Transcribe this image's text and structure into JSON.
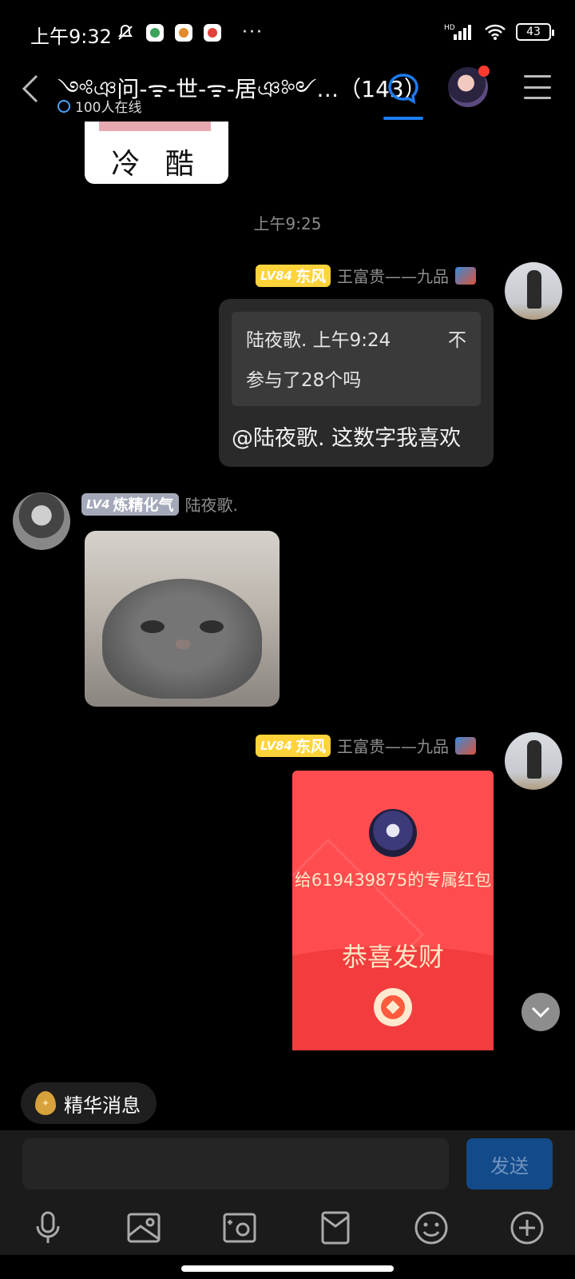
{
  "status_bar": {
    "time": "上午9:32",
    "more": "···",
    "network": "HD",
    "battery": "43"
  },
  "header": {
    "title": "༺ঞ问-ᯤ-世-ᯤ-居ঞ༻…（143）",
    "online": "100人在线",
    "accent": "#1e7cf2"
  },
  "messages": {
    "sticker_text": "冷 酷",
    "timestamp": "上午9:25",
    "msg1": {
      "level": "LV84",
      "title": "东风",
      "sender": "王富贵——九品",
      "quote_head": "陆夜歌. 上午9:24",
      "quote_end": "不",
      "quote_body": "参与了28个吗",
      "text": "@陆夜歌. 这数字我喜欢"
    },
    "msg2": {
      "level": "LV4",
      "title": "炼精化气",
      "sender": "陆夜歌."
    },
    "msg3": {
      "level": "LV84",
      "title": "东风",
      "sender": "王富贵——九品",
      "packet_to": "给619439875的专属红包",
      "packet_wish": "恭喜发财"
    }
  },
  "essence": {
    "label": "精华消息"
  },
  "composer": {
    "placeholder": "",
    "send_label": "发送"
  },
  "toolbar_icons": [
    "microphone-icon",
    "image-icon",
    "camera-icon",
    "red-packet-icon",
    "emoji-icon",
    "plus-icon"
  ]
}
